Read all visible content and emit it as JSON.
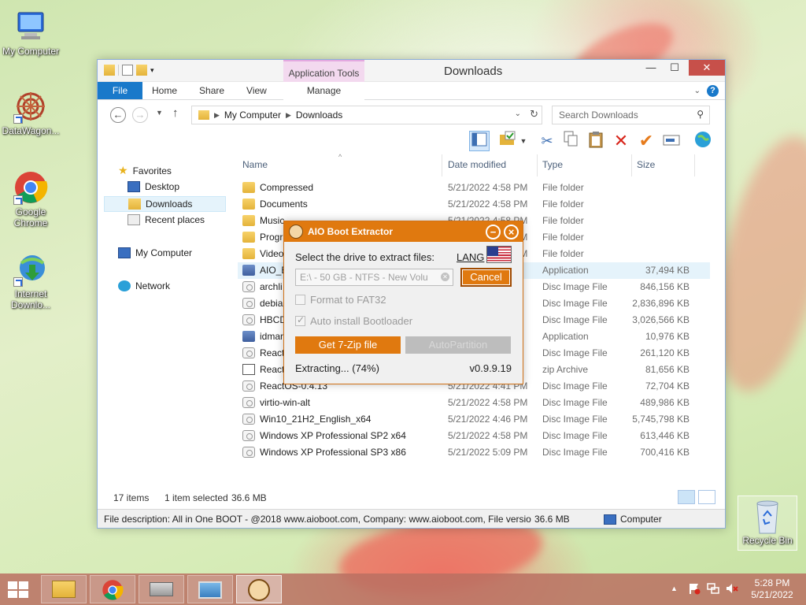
{
  "desktop": {
    "icons": [
      {
        "label": "My Computer"
      },
      {
        "label": "DataWagon..."
      },
      {
        "label": "Google Chrome"
      },
      {
        "label": "Internet Downlo..."
      }
    ],
    "recycle_bin": "Recycle Bin"
  },
  "explorer": {
    "title": "Downloads",
    "application_tools": "Application Tools",
    "tabs": {
      "file": "File",
      "home": "Home",
      "share": "Share",
      "view": "View",
      "manage": "Manage"
    },
    "address": {
      "root": "My Computer",
      "folder": "Downloads"
    },
    "search_placeholder": "Search Downloads",
    "nav": {
      "favorites": "Favorites",
      "desktop": "Desktop",
      "downloads": "Downloads",
      "recent": "Recent places",
      "my_computer": "My Computer",
      "network": "Network"
    },
    "columns": {
      "name": "Name",
      "date": "Date modified",
      "type": "Type",
      "size": "Size"
    },
    "files": [
      {
        "name": "Compressed",
        "date": "5/21/2022 4:58 PM",
        "type": "File folder",
        "size": "",
        "icon": "folder"
      },
      {
        "name": "Documents",
        "date": "5/21/2022 4:58 PM",
        "type": "File folder",
        "size": "",
        "icon": "folder"
      },
      {
        "name": "Music",
        "date": "5/21/2022 4:58 PM",
        "type": "File folder",
        "size": "",
        "icon": "folder"
      },
      {
        "name": "Progra",
        "date": "5/21/2022 4:58 PM",
        "type": "File folder",
        "size": "",
        "icon": "folder"
      },
      {
        "name": "Video",
        "date": "5/21/2022 4:58 PM",
        "type": "File folder",
        "size": "",
        "icon": "folder"
      },
      {
        "name": "AIO_B",
        "date": "",
        "type": "Application",
        "size": "37,494 KB",
        "icon": "app"
      },
      {
        "name": "archli",
        "date": "",
        "type": "Disc Image File",
        "size": "846,156 KB",
        "icon": "disc"
      },
      {
        "name": "debiar",
        "date": "",
        "type": "Disc Image File",
        "size": "2,836,896 KB",
        "icon": "disc"
      },
      {
        "name": "HBCD",
        "date": "",
        "type": "Disc Image File",
        "size": "3,026,566 KB",
        "icon": "disc"
      },
      {
        "name": "idmar",
        "date": "",
        "type": "Application",
        "size": "10,976 KB",
        "icon": "app"
      },
      {
        "name": "React",
        "date": "",
        "type": "Disc Image File",
        "size": "261,120 KB",
        "icon": "disc"
      },
      {
        "name": "React",
        "date": "",
        "type": "zip Archive",
        "size": "81,656 KB",
        "icon": "zip"
      },
      {
        "name": "ReactOS-0.4.13",
        "date": "5/21/2022 4:41 PM",
        "type": "Disc Image File",
        "size": "72,704 KB",
        "icon": "disc"
      },
      {
        "name": "virtio-win-alt",
        "date": "5/21/2022 4:58 PM",
        "type": "Disc Image File",
        "size": "489,986 KB",
        "icon": "disc"
      },
      {
        "name": "Win10_21H2_English_x64",
        "date": "5/21/2022 4:46 PM",
        "type": "Disc Image File",
        "size": "5,745,798 KB",
        "icon": "disc"
      },
      {
        "name": "Windows XP Professional SP2 x64",
        "date": "5/21/2022 4:58 PM",
        "type": "Disc Image File",
        "size": "613,446 KB",
        "icon": "disc"
      },
      {
        "name": "Windows XP Professional SP3 x86",
        "date": "5/21/2022 5:09 PM",
        "type": "Disc Image File",
        "size": "700,416 KB",
        "icon": "disc"
      }
    ],
    "status": {
      "items": "17 items",
      "selected": "1 item selected",
      "size": "36.6 MB"
    },
    "description": {
      "text": "File description: All in One BOOT - @2018 www.aioboot.com, Company: www.aioboot.com, File versio",
      "size": "36.6 MB",
      "location": "Computer"
    }
  },
  "dialog": {
    "title": "AIO Boot Extractor",
    "select_label": "Select the drive to extract files:",
    "lang": "LANG",
    "drive": "E:\\ - 50 GB - NTFS - New Volu",
    "cancel": "Cancel",
    "format_fat32": "Format to FAT32",
    "auto_install": "Auto install Bootloader",
    "get_7zip": "Get 7-Zip file",
    "autopartition": "AutoPartition",
    "progress_text": "Extracting... (74%)",
    "progress": 0.74,
    "version": "v0.9.9.19"
  },
  "taskbar": {
    "time": "5:28 PM",
    "date": "5/21/2022"
  },
  "colors": {
    "accent_orange": "#e0790f",
    "explorer_blue": "#1979ca"
  }
}
